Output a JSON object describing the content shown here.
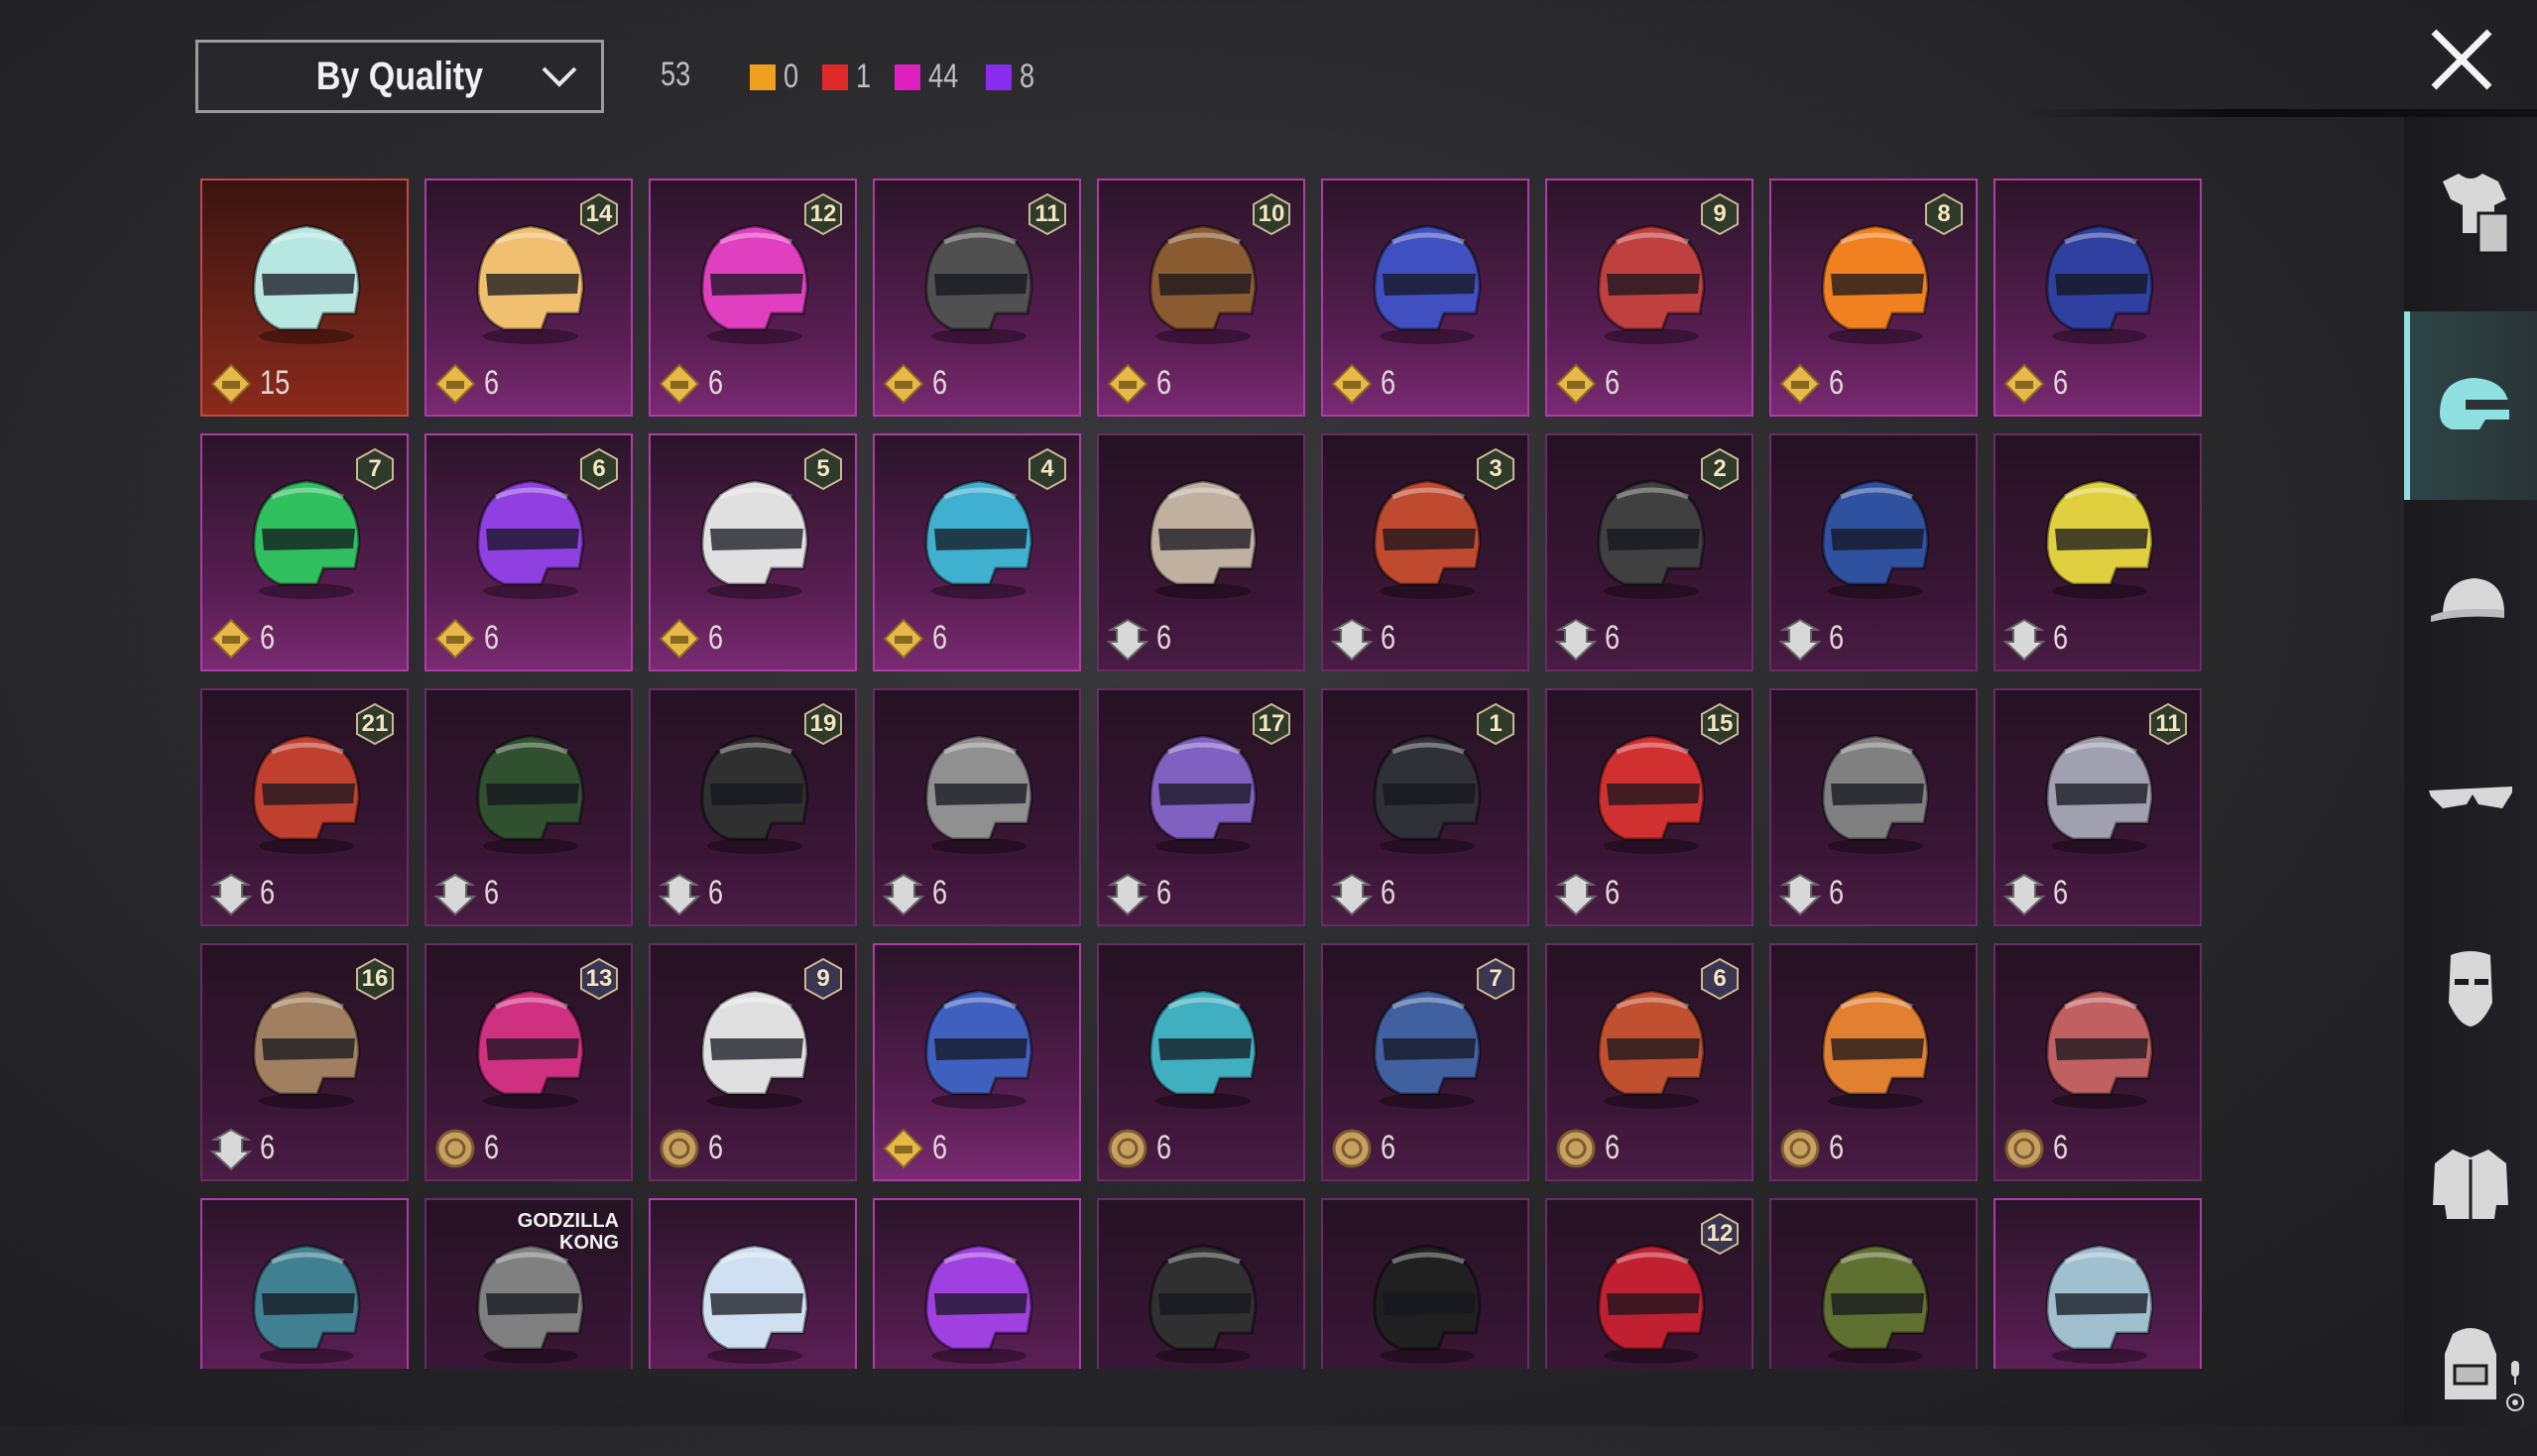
{
  "header": {
    "sort_label": "By Quality",
    "total": "53",
    "legend": [
      {
        "color": "#f0a020",
        "count": "0"
      },
      {
        "color": "#e02a2a",
        "count": "1"
      },
      {
        "color": "#e020c0",
        "count": "44"
      },
      {
        "color": "#8a2cf0",
        "count": "8"
      }
    ]
  },
  "colors": {
    "tile_border_pink": "#b03aa8",
    "tile_border_red": "#c8464a",
    "active_tab_accent": "#8fe0e0"
  },
  "tiles": [
    {
      "count": "15",
      "level": "",
      "coin": "gold",
      "quality": "red",
      "helmet_color": "#b8e6e0"
    },
    {
      "count": "6",
      "level": "14",
      "coin": "gold",
      "quality": "pink",
      "helmet_color": "#f0c070"
    },
    {
      "count": "6",
      "level": "12",
      "coin": "gold",
      "quality": "pink",
      "helmet_color": "#e040c0"
    },
    {
      "count": "6",
      "level": "11",
      "coin": "gold",
      "quality": "pink",
      "helmet_color": "#505050"
    },
    {
      "count": "6",
      "level": "10",
      "coin": "gold",
      "quality": "pink",
      "helmet_color": "#8a5a30"
    },
    {
      "count": "6",
      "level": "",
      "coin": "gold",
      "quality": "pink",
      "helmet_color": "#4050c0"
    },
    {
      "count": "6",
      "level": "9",
      "coin": "gold",
      "quality": "pink",
      "helmet_color": "#c04040"
    },
    {
      "count": "6",
      "level": "8",
      "coin": "gold",
      "quality": "pink",
      "helmet_color": "#f08020"
    },
    {
      "count": "6",
      "level": "",
      "coin": "gold",
      "quality": "pink",
      "helmet_color": "#3040a0"
    },
    {
      "count": "6",
      "level": "7",
      "coin": "gold",
      "quality": "pink",
      "helmet_color": "#30c060"
    },
    {
      "count": "6",
      "level": "6",
      "coin": "gold",
      "quality": "pink",
      "helmet_color": "#9040e0"
    },
    {
      "count": "6",
      "level": "5",
      "coin": "gold",
      "quality": "pink",
      "helmet_color": "#e0e0e0"
    },
    {
      "count": "6",
      "level": "4",
      "coin": "gold",
      "quality": "pink",
      "helmet_color": "#40b0d0"
    },
    {
      "count": "6",
      "level": "",
      "coin": "silver",
      "quality": "dim",
      "helmet_color": "#c0b0a0"
    },
    {
      "count": "6",
      "level": "3",
      "coin": "silver",
      "quality": "dim",
      "helmet_color": "#c04a30"
    },
    {
      "count": "6",
      "level": "2",
      "coin": "silver",
      "quality": "dim",
      "helmet_color": "#404040"
    },
    {
      "count": "6",
      "level": "",
      "coin": "silver",
      "quality": "dim",
      "helmet_color": "#3050a0"
    },
    {
      "count": "6",
      "level": "",
      "coin": "silver",
      "quality": "dim",
      "helmet_color": "#e0d040"
    },
    {
      "count": "6",
      "level": "21",
      "coin": "silver",
      "quality": "dim",
      "helmet_color": "#c04030"
    },
    {
      "count": "6",
      "level": "",
      "coin": "silver",
      "quality": "dim",
      "helmet_color": "#305030"
    },
    {
      "count": "6",
      "level": "19",
      "coin": "silver",
      "quality": "dim",
      "helmet_color": "#303030"
    },
    {
      "count": "6",
      "level": "",
      "coin": "silver",
      "quality": "dim",
      "helmet_color": "#909090"
    },
    {
      "count": "6",
      "level": "17",
      "coin": "silver",
      "quality": "dim",
      "helmet_color": "#8060c0"
    },
    {
      "count": "6",
      "level": "1",
      "coin": "silver",
      "quality": "dim",
      "helmet_color": "#303038"
    },
    {
      "count": "6",
      "level": "15",
      "coin": "silver",
      "quality": "dim",
      "helmet_color": "#d03030"
    },
    {
      "count": "6",
      "level": "",
      "coin": "silver",
      "quality": "dim",
      "helmet_color": "#808080"
    },
    {
      "count": "6",
      "level": "11",
      "coin": "silver",
      "quality": "dim",
      "helmet_color": "#a0a0b0"
    },
    {
      "count": "6",
      "level": "16",
      "coin": "silver",
      "quality": "dim",
      "helmet_color": "#a08060"
    },
    {
      "count": "6",
      "level": "13",
      "coin": "bronze",
      "quality": "dim",
      "helmet_color": "#d03080"
    },
    {
      "count": "6",
      "level": "9",
      "coin": "bronze",
      "quality": "dim",
      "helmet_color": "#e0e0e0"
    },
    {
      "count": "6",
      "level": "",
      "coin": "gold",
      "quality": "pink",
      "helmet_color": "#4060c0"
    },
    {
      "count": "6",
      "level": "",
      "coin": "bronze",
      "quality": "dim",
      "helmet_color": "#40b0c0"
    },
    {
      "count": "6",
      "level": "7",
      "coin": "bronze",
      "quality": "dim",
      "helmet_color": "#4060a0"
    },
    {
      "count": "6",
      "level": "6",
      "coin": "bronze",
      "quality": "dim",
      "helmet_color": "#c05030"
    },
    {
      "count": "6",
      "level": "",
      "coin": "bronze",
      "quality": "dim",
      "helmet_color": "#e08030"
    },
    {
      "count": "6",
      "level": "",
      "coin": "bronze",
      "quality": "dim",
      "helmet_color": "#c06060"
    },
    {
      "count": "",
      "level": "",
      "coin": "",
      "quality": "pink",
      "helmet_color": "#408090"
    },
    {
      "count": "",
      "level": "",
      "coin": "",
      "quality": "dim",
      "helmet_color": "#808080",
      "brand": "GODZILLA KONG"
    },
    {
      "count": "",
      "level": "",
      "coin": "",
      "quality": "pink",
      "helmet_color": "#d0e0f0"
    },
    {
      "count": "",
      "level": "",
      "coin": "",
      "quality": "pink",
      "helmet_color": "#a040e0"
    },
    {
      "count": "",
      "level": "",
      "coin": "",
      "quality": "dim",
      "helmet_color": "#303030"
    },
    {
      "count": "",
      "level": "",
      "coin": "",
      "quality": "dim",
      "helmet_color": "#202020"
    },
    {
      "count": "",
      "level": "12",
      "coin": "",
      "quality": "dim",
      "helmet_color": "#c02030"
    },
    {
      "count": "",
      "level": "",
      "coin": "",
      "quality": "dim",
      "helmet_color": "#607030"
    },
    {
      "count": "",
      "level": "",
      "coin": "",
      "quality": "pink",
      "helmet_color": "#a0c0d0"
    }
  ],
  "sidebar": {
    "tabs": [
      {
        "icon": "outfit-icon",
        "active": false
      },
      {
        "icon": "helmet-icon",
        "active": true
      },
      {
        "icon": "cap-icon",
        "active": false
      },
      {
        "icon": "glasses-icon",
        "active": false
      },
      {
        "icon": "mask-icon",
        "active": false
      },
      {
        "icon": "jacket-icon",
        "active": false
      },
      {
        "icon": "backpack-icon",
        "active": false
      }
    ]
  }
}
